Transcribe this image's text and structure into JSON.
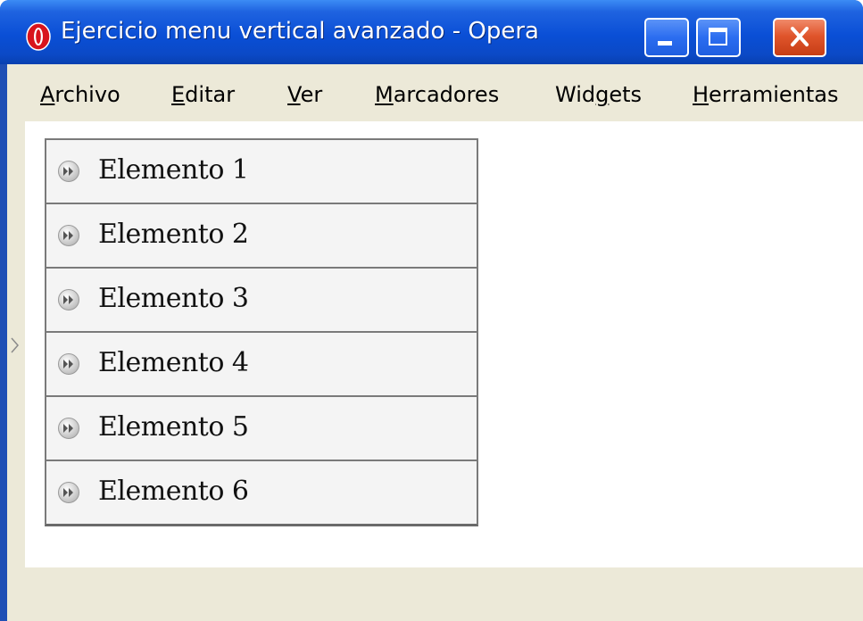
{
  "window": {
    "title": "Ejercicio menu vertical avanzado - Opera",
    "app_icon": "opera-logo-icon",
    "controls": {
      "minimize_icon": "minimize-icon",
      "maximize_icon": "maximize-icon",
      "close_icon": "close-icon"
    },
    "colors": {
      "titlebar": "#0a4fd6",
      "close": "#e0552c",
      "chrome": "#ece9d8"
    }
  },
  "menubar": {
    "items": [
      {
        "label_ul": "A",
        "label_rest": "rchivo"
      },
      {
        "label_ul": "E",
        "label_rest": "ditar"
      },
      {
        "label_ul": "V",
        "label_rest": "er"
      },
      {
        "label_ul": "M",
        "label_rest": "arcadores"
      },
      {
        "label_pre": "Wid",
        "label_ul": "g",
        "label_rest": "ets"
      },
      {
        "label_ul": "H",
        "label_rest": "erramientas"
      }
    ]
  },
  "vertical_menu": {
    "bullet_icon": "fast-forward-bullet-icon",
    "items": [
      {
        "label": "Elemento 1"
      },
      {
        "label": "Elemento 2"
      },
      {
        "label": "Elemento 3"
      },
      {
        "label": "Elemento 4"
      },
      {
        "label": "Elemento 5"
      },
      {
        "label": "Elemento 6"
      }
    ]
  }
}
